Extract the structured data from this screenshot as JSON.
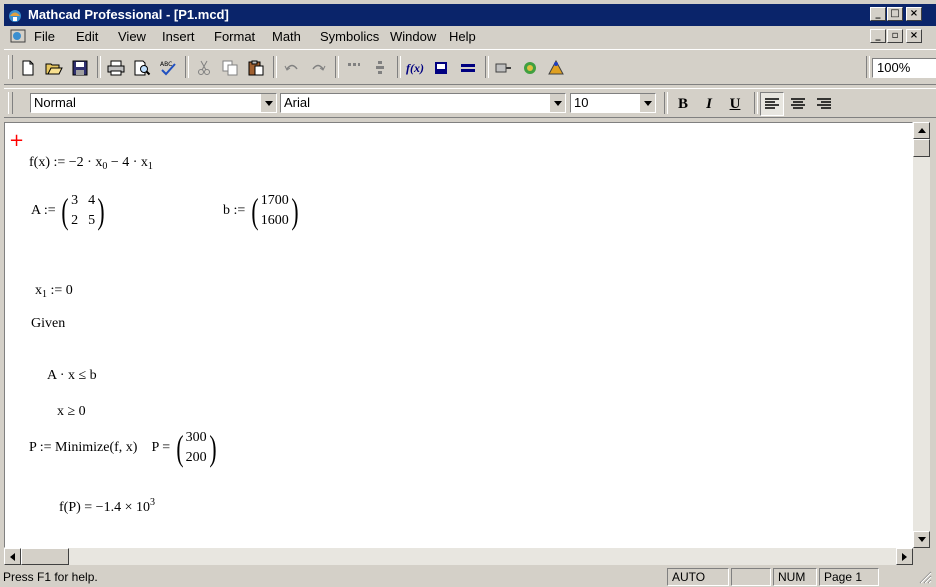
{
  "window": {
    "title": "Mathcad Professional - [P1.mcd]"
  },
  "menu": {
    "items": [
      "File",
      "Edit",
      "View",
      "Insert",
      "Format",
      "Math",
      "Symbolics",
      "Window",
      "Help"
    ]
  },
  "toolbar": {
    "icons": [
      "new-document",
      "open-folder",
      "save",
      "print",
      "print-preview",
      "spell-check",
      "cut",
      "copy",
      "paste",
      "undo",
      "redo",
      "insert-region",
      "align-region",
      "insert-function",
      "insert-unit",
      "calculate",
      "resource-center",
      "component",
      "component-wizard"
    ],
    "zoom": "100%"
  },
  "format": {
    "style": "Normal",
    "font": "Arial",
    "size": "10",
    "bold": "B",
    "italic": "I",
    "underline": "U"
  },
  "worksheet": {
    "f_def": {
      "lhs": "f(x) := −2 · x",
      "sub0": "0",
      "mid": " − 4 · x",
      "sub1": "1"
    },
    "A_def": {
      "lhs": "A :=",
      "matrix": [
        [
          "3",
          "4"
        ],
        [
          "2",
          "5"
        ]
      ]
    },
    "b_def": {
      "lhs": "b :=",
      "matrix": [
        [
          "1700"
        ],
        [
          "1600"
        ]
      ]
    },
    "x1_def": {
      "x": "x",
      "sub": "1",
      "rhs": " := 0"
    },
    "given": "Given",
    "constraint1": "A · x ≤ b",
    "constraint2": "x ≥ 0",
    "minimize": "P := Minimize(f, x)",
    "P_result": {
      "lhs": "P =",
      "matrix": [
        [
          "300"
        ],
        [
          "200"
        ]
      ]
    },
    "fP_result": {
      "lhs": "f(P) = −1.4 × 10",
      "exp": "3"
    }
  },
  "status": {
    "help": "Press F1 for help.",
    "mode": "AUTO",
    "blank": "",
    "num": "NUM",
    "page": "Page 1"
  }
}
